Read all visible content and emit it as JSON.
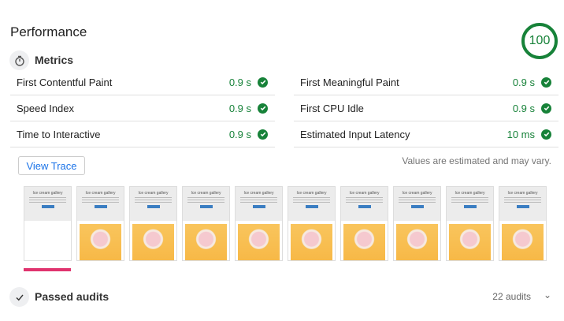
{
  "title": "Performance",
  "score": "100",
  "colors": {
    "pass": "#178239",
    "accent": "#1a73e8",
    "filmstrip_marker": "#e0336e"
  },
  "metrics_section": {
    "label": "Metrics",
    "icon": "stopwatch-icon"
  },
  "metrics": [
    {
      "label": "First Contentful Paint",
      "value": "0.9 s"
    },
    {
      "label": "First Meaningful Paint",
      "value": "0.9 s"
    },
    {
      "label": "Speed Index",
      "value": "0.9 s"
    },
    {
      "label": "First CPU Idle",
      "value": "0.9 s"
    },
    {
      "label": "Time to Interactive",
      "value": "0.9 s"
    },
    {
      "label": "Estimated Input Latency",
      "value": "10 ms"
    }
  ],
  "view_trace": "View Trace",
  "note": "Values are estimated and may vary.",
  "filmstrip": {
    "page_heading": "Ice cream gallery",
    "frames": [
      {
        "image_loaded": false
      },
      {
        "image_loaded": true
      },
      {
        "image_loaded": true
      },
      {
        "image_loaded": true
      },
      {
        "image_loaded": true
      },
      {
        "image_loaded": true
      },
      {
        "image_loaded": true
      },
      {
        "image_loaded": true
      },
      {
        "image_loaded": true
      },
      {
        "image_loaded": true
      }
    ]
  },
  "passed": {
    "label": "Passed audits",
    "count": "22 audits",
    "icon": "checkmark-icon"
  }
}
